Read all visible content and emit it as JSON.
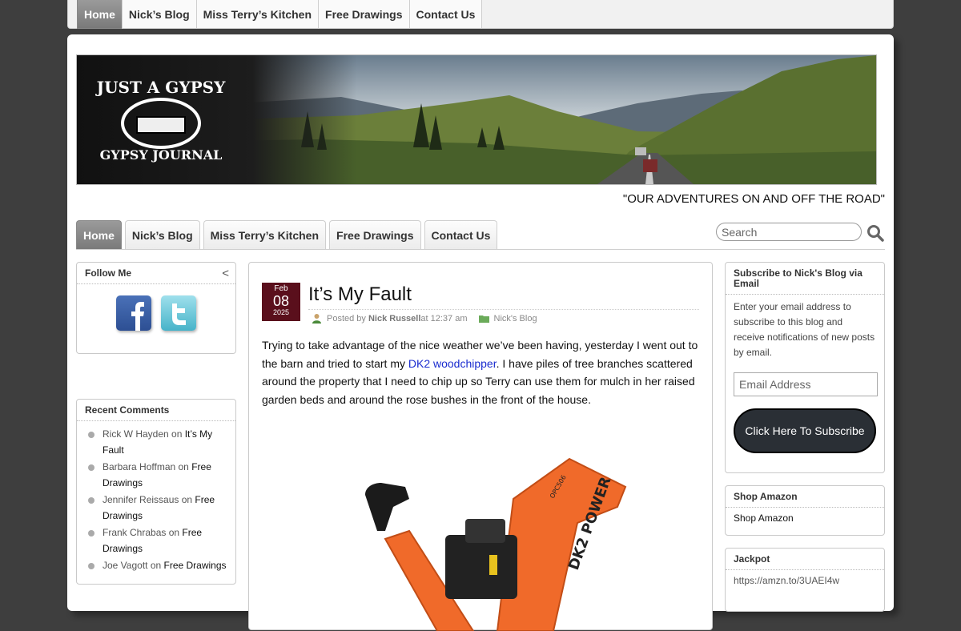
{
  "nav": {
    "items": [
      {
        "label": "Home",
        "active": true
      },
      {
        "label": "Nick’s Blog",
        "active": false
      },
      {
        "label": "Miss Terry’s Kitchen",
        "active": false
      },
      {
        "label": "Free Drawings",
        "active": false
      },
      {
        "label": "Contact Us",
        "active": false
      }
    ]
  },
  "header": {
    "logo_text_top": "JUST A GYPSY",
    "logo_text_bottom": "GYPSY JOURNAL",
    "tagline": "\"OUR ADVENTURES ON AND OFF THE ROAD\""
  },
  "search": {
    "placeholder": "Search"
  },
  "follow": {
    "title": "Follow Me",
    "icons": [
      "facebook-icon",
      "twitter-icon"
    ]
  },
  "recent_comments": {
    "title": "Recent Comments",
    "items": [
      {
        "author": "Rick W Hayden",
        "on": " on ",
        "post": "It’s My Fault"
      },
      {
        "author": "Barbara Hoffman",
        "on": " on ",
        "post": "Free Drawings"
      },
      {
        "author": "Jennifer Reissaus",
        "on": " on ",
        "post": "Free Drawings"
      },
      {
        "author": "Frank Chrabas",
        "on": " on ",
        "post": "Free Drawings"
      },
      {
        "author": "Joe Vagott",
        "on": " on ",
        "post": "Free Drawings"
      }
    ]
  },
  "post": {
    "month": "Feb",
    "day": "08",
    "year": "2025",
    "title": "It’s My Fault",
    "meta_prefix": "Posted by ",
    "author": "Nick Russell",
    "meta_time": " at 12:37 am",
    "category": "Nick's Blog",
    "body_before": "Trying to take advantage of the nice weather we’ve been having, yesterday I went out to the barn and tried to start my ",
    "link_text": "DK2 woodchipper",
    "body_after": ". I have piles of tree branches scattered around the property that I need to chip up so Terry can use them for mulch in her raised garden beds and around the rose bushes in the front of the house.",
    "image_brand": "DK2 POWER",
    "image_model": "OPC506"
  },
  "subscribe": {
    "title": "Subscribe to Nick's Blog via Email",
    "text": "Enter your email address to subscribe to this blog and receive notifications of new posts by email.",
    "placeholder": "Email Address",
    "button": "Click Here To Subscribe"
  },
  "amazon": {
    "title": "Shop Amazon",
    "link": "Shop Amazon"
  },
  "jackpot": {
    "title": "Jackpot",
    "link": "https://amzn.to/3UAEI4w"
  },
  "colors": {
    "date_badge": "#5a0f1c",
    "link": "#1a2ccf",
    "chipper": "#f06a2a"
  }
}
